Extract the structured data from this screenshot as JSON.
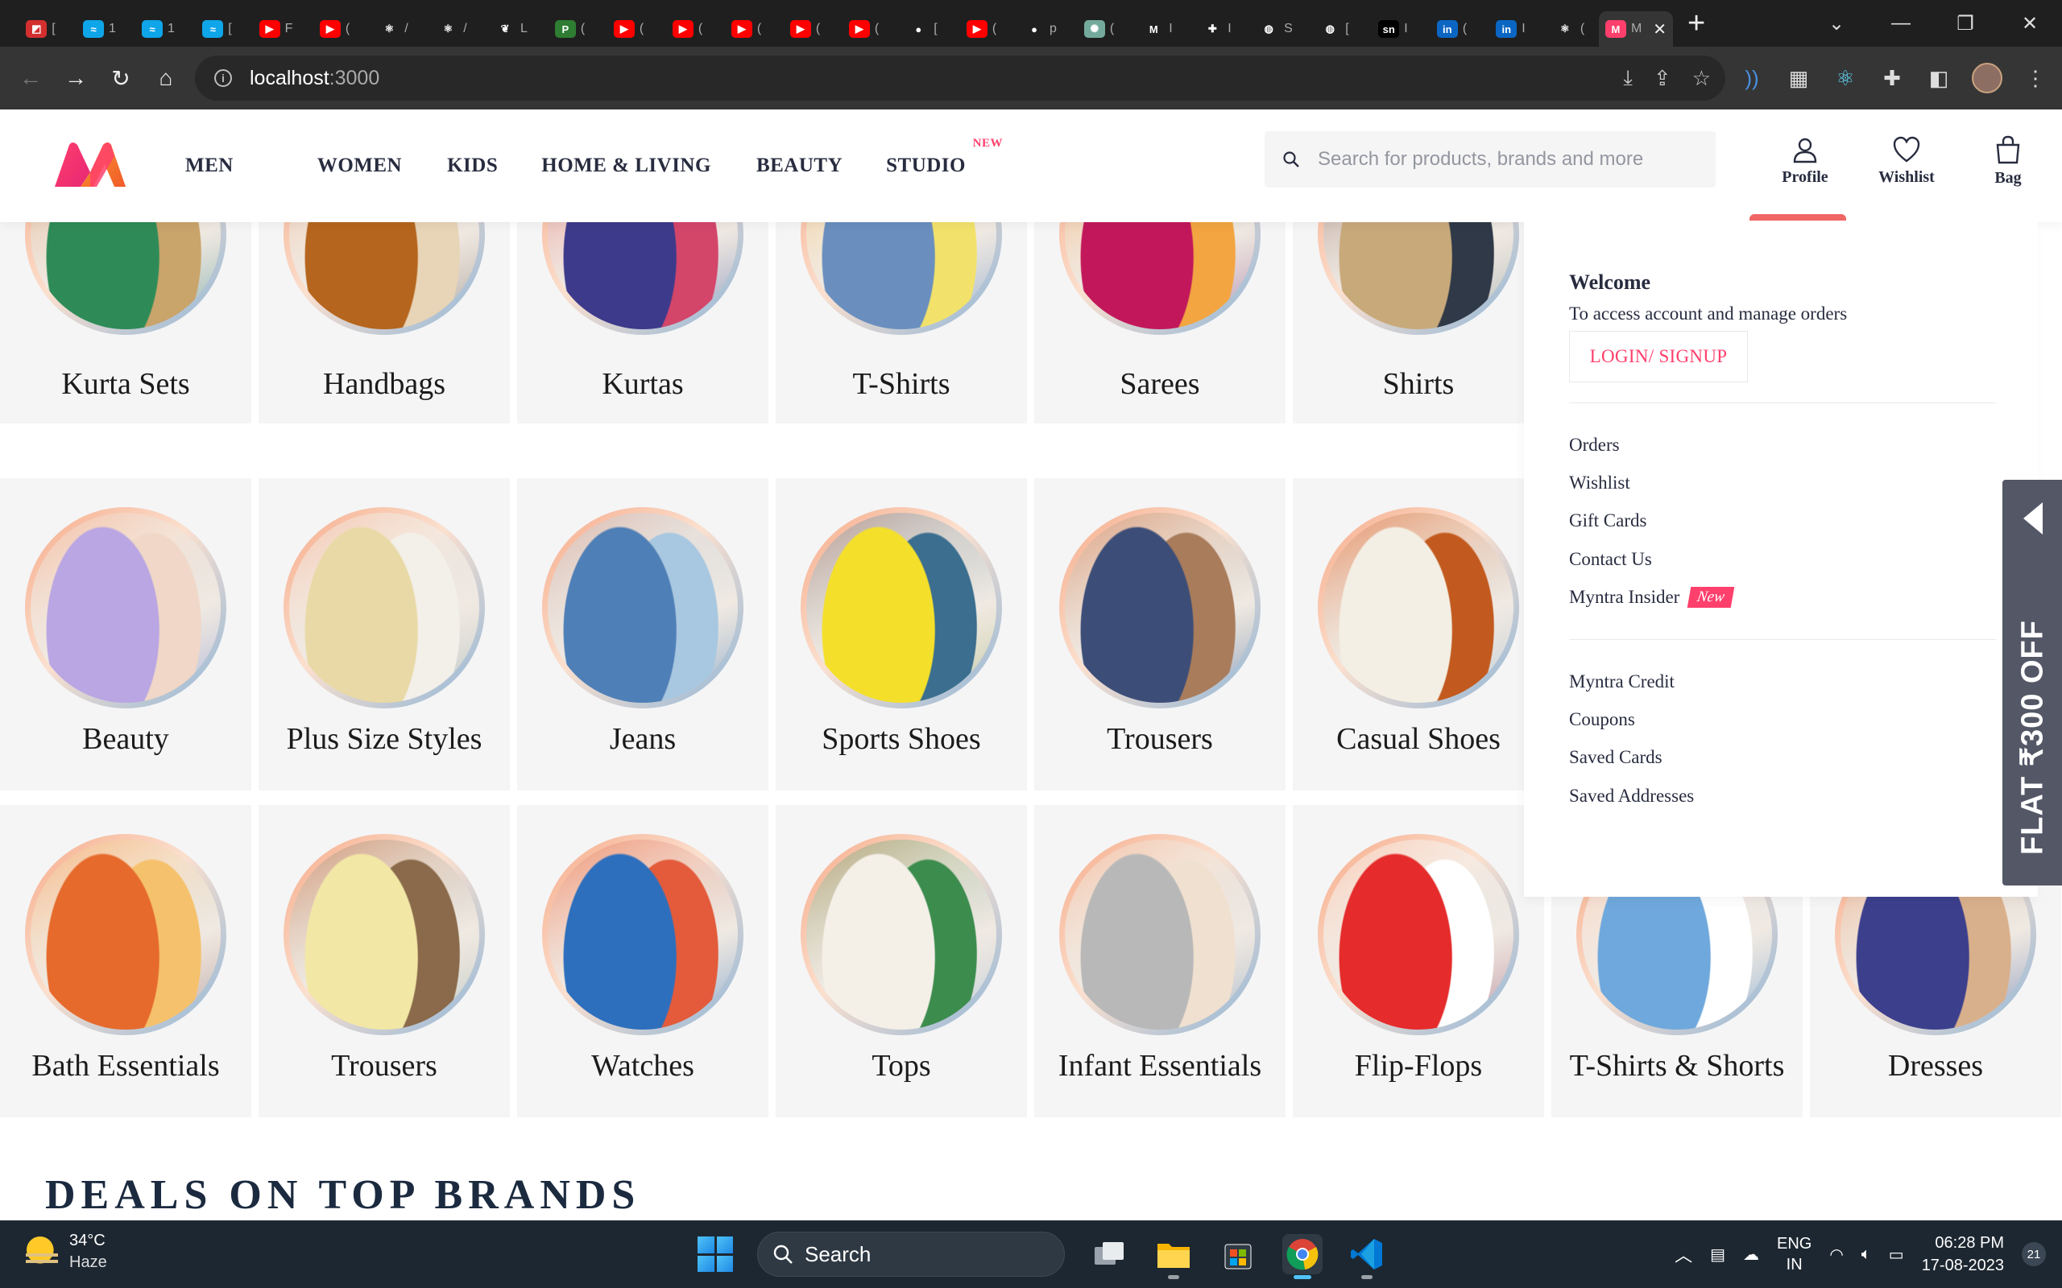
{
  "browser": {
    "tabs": [
      {
        "icon": "pdf-icon",
        "color": "#d32f2f",
        "glyph": "◩",
        "title": "["
      },
      {
        "icon": "tailwind-icon",
        "color": "#0ea5e9",
        "glyph": "≈",
        "title": "1"
      },
      {
        "icon": "tailwind-icon",
        "color": "#0ea5e9",
        "glyph": "≈",
        "title": "1"
      },
      {
        "icon": "tailwind-icon",
        "color": "#0ea5e9",
        "glyph": "≈",
        "title": "["
      },
      {
        "icon": "youtube-icon",
        "color": "#ff0000",
        "glyph": "▶",
        "title": "F"
      },
      {
        "icon": "youtube-icon",
        "color": "#ff0000",
        "glyph": "▶",
        "title": "("
      },
      {
        "icon": "react-icon",
        "color": "#1f1f1f",
        "glyph": "⚛",
        "title": "/"
      },
      {
        "icon": "react-icon",
        "color": "#1f1f1f",
        "glyph": "⚛",
        "title": "/"
      },
      {
        "icon": "mongodb-icon",
        "color": "#1f1f1f",
        "glyph": "❦",
        "title": "L"
      },
      {
        "icon": "codepen-icon",
        "color": "#2e7d32",
        "glyph": "P",
        "title": "("
      },
      {
        "icon": "youtube-icon",
        "color": "#ff0000",
        "glyph": "▶",
        "title": "("
      },
      {
        "icon": "youtube-icon",
        "color": "#ff0000",
        "glyph": "▶",
        "title": "("
      },
      {
        "icon": "youtube-icon",
        "color": "#ff0000",
        "glyph": "▶",
        "title": "("
      },
      {
        "icon": "youtube-icon",
        "color": "#ff0000",
        "glyph": "▶",
        "title": "("
      },
      {
        "icon": "youtube-icon",
        "color": "#ff0000",
        "glyph": "▶",
        "title": "("
      },
      {
        "icon": "github-icon",
        "color": "#1f1f1f",
        "glyph": "●",
        "title": "["
      },
      {
        "icon": "youtube-icon",
        "color": "#ff0000",
        "glyph": "▶",
        "title": "("
      },
      {
        "icon": "github-icon",
        "color": "#1f1f1f",
        "glyph": "●",
        "title": "p"
      },
      {
        "icon": "chatgpt-icon",
        "color": "#74aa9c",
        "glyph": "✺",
        "title": "("
      },
      {
        "icon": "medium-icon",
        "color": "#1f1f1f",
        "glyph": "M",
        "title": "I"
      },
      {
        "icon": "extension-icon",
        "color": "#1f1f1f",
        "glyph": "✚",
        "title": "I"
      },
      {
        "icon": "globe-icon",
        "color": "#1f1f1f",
        "glyph": "◍",
        "title": "S"
      },
      {
        "icon": "globe-icon",
        "color": "#1f1f1f",
        "glyph": "◍",
        "title": "["
      },
      {
        "icon": "sn-icon",
        "color": "#000000",
        "glyph": "sn",
        "title": "I"
      },
      {
        "icon": "linkedin-icon",
        "color": "#0a66c2",
        "glyph": "in",
        "title": "("
      },
      {
        "icon": "linkedin-icon",
        "color": "#0a66c2",
        "glyph": "in",
        "title": "I"
      },
      {
        "icon": "react-icon",
        "color": "#1f1f1f",
        "glyph": "⚛",
        "title": "("
      }
    ],
    "active_tab": {
      "icon": "myntra-icon",
      "title": "M"
    },
    "url_host": "localhost",
    "url_port": ":3000"
  },
  "header": {
    "nav": [
      {
        "label": "MEN",
        "left": 0
      },
      {
        "label": "WOMEN",
        "left": 0
      },
      {
        "label": "KIDS",
        "left": 0
      },
      {
        "label": "HOME & LIVING",
        "left": 0
      },
      {
        "label": "BEAUTY",
        "left": 0
      },
      {
        "label": "STUDIO",
        "left": 0
      }
    ],
    "studio_badge": "NEW",
    "search_placeholder": "Search for products, brands and more",
    "actions": {
      "profile": "Profile",
      "wishlist": "Wishlist",
      "bag": "Bag"
    }
  },
  "categories": [
    {
      "label": "Kurta Sets"
    },
    {
      "label": "Handbags"
    },
    {
      "label": "Kurtas"
    },
    {
      "label": "T-Shirts"
    },
    {
      "label": "Sarees"
    },
    {
      "label": "Shirts"
    },
    {
      "label": "Beauty"
    },
    {
      "label": "Plus Size Styles"
    },
    {
      "label": "Jeans"
    },
    {
      "label": "Sports Shoes"
    },
    {
      "label": "Trousers"
    },
    {
      "label": "Casual Shoes"
    },
    {
      "label": "Bath Essentials"
    },
    {
      "label": "Trousers"
    },
    {
      "label": "Watches"
    },
    {
      "label": "Tops"
    },
    {
      "label": "Infant Essentials"
    },
    {
      "label": "Flip-Flops"
    },
    {
      "label": "T-Shirts & Shorts"
    },
    {
      "label": "Dresses"
    }
  ],
  "profile_menu": {
    "welcome": "Welcome",
    "subtitle": "To access account and manage orders",
    "login_label": "LOGIN/ SIGNUP",
    "group1": [
      "Orders",
      "Wishlist",
      "Gift Cards",
      "Contact Us",
      "Myntra Insider"
    ],
    "insider_badge": "New",
    "group2": [
      "Myntra Credit",
      "Coupons",
      "Saved Cards",
      "Saved Addresses"
    ]
  },
  "promo_tab": "FLAT ₹300 OFF",
  "deals_title": "DEALS ON TOP BRANDS",
  "taskbar": {
    "temperature": "34°C",
    "weather": "Haze",
    "search_label": "Search",
    "lang_line1": "ENG",
    "lang_line2": "IN",
    "time": "06:28 PM",
    "date": "17-08-2023",
    "notifications": "21"
  },
  "colors": {
    "brand_pink": "#ff3f6c",
    "brand_orange": "#f89a2e",
    "header_text": "#282c3f",
    "promo_tab_bg": "#535766"
  }
}
